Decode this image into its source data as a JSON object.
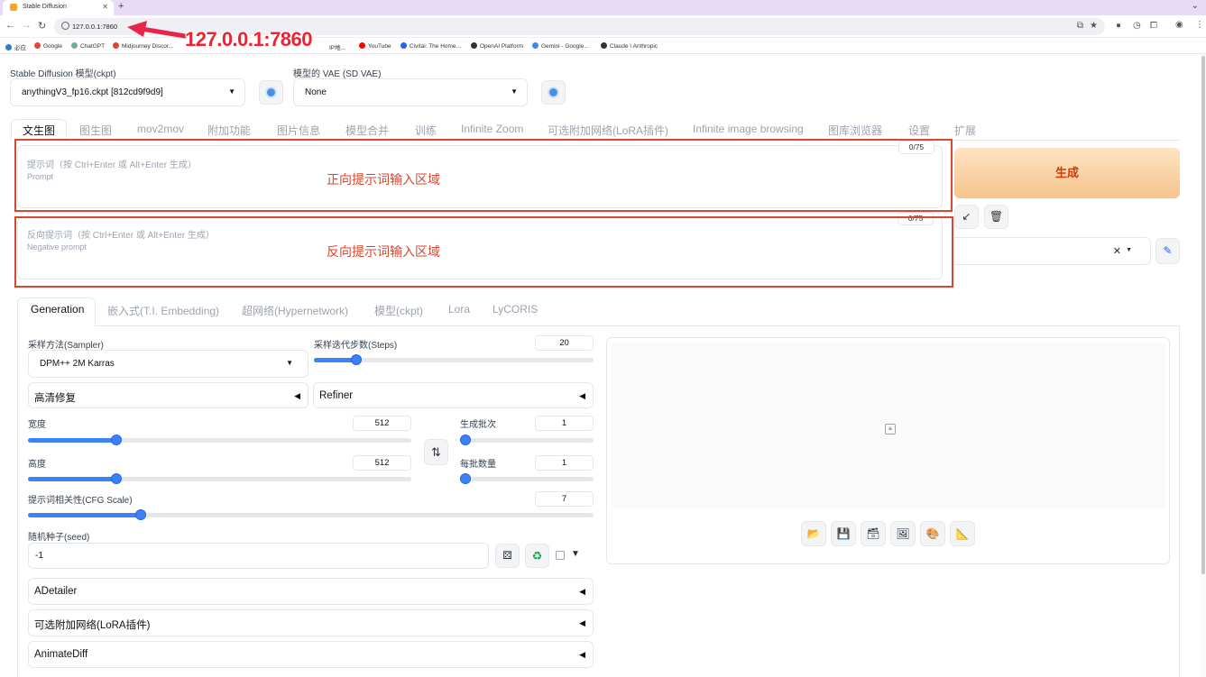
{
  "browser": {
    "tab_title": "Stable Diffusion",
    "url": "127.0.0.1:7860",
    "bookmarks": [
      {
        "label": "必应",
        "color": "#2b7cd3"
      },
      {
        "label": "Google",
        "color": "#ea4335"
      },
      {
        "label": "ChatGPT",
        "color": "#74aa9c"
      },
      {
        "label": "Midjourney Discor...",
        "color": "#d9472f"
      },
      {
        "label": "IP地...",
        "color": "#888888"
      },
      {
        "label": "YouTube",
        "color": "#ff0000"
      },
      {
        "label": "Civitai: The Home...",
        "color": "#1c64f2"
      },
      {
        "label": "OpenAI Platform",
        "color": "#333333"
      },
      {
        "label": "Gemini - Google...",
        "color": "#4285f4"
      },
      {
        "label": "Claude \\ Anthropic",
        "color": "#333333"
      }
    ]
  },
  "annotation": {
    "url_callout": "127.0.0.1:7860",
    "color": "#e8244a"
  },
  "model": {
    "ckpt_label": "Stable Diffusion 模型(ckpt)",
    "ckpt_value": "anythingV3_fp16.ckpt [812cd9f9d9]",
    "vae_label": "模型的 VAE (SD VAE)",
    "vae_value": "None"
  },
  "main_tabs": [
    "文生图",
    "图生图",
    "mov2mov",
    "附加功能",
    "图片信息",
    "模型合并",
    "训练",
    "Infinite Zoom",
    "可选附加网络(LoRA插件)",
    "Infinite image browsing",
    "图库浏览器",
    "设置",
    "扩展"
  ],
  "prompt": {
    "placeholder": "提示词（按 Ctrl+Enter 或 Alt+Enter 生成）",
    "placeholder_en": "Prompt",
    "counter": "0/75",
    "annotation": "正向提示词输入区域"
  },
  "negative_prompt": {
    "placeholder": "反向提示词（按 Ctrl+Enter 或 Alt+Enter 生成）",
    "placeholder_en": "Negative prompt",
    "counter": "0/75",
    "annotation": "反向提示词输入区域"
  },
  "generate_label": "生成",
  "annotation_color": "#d9472f",
  "sub_tabs": [
    "Generation",
    "嵌入式(T.I. Embedding)",
    "超网络(Hypernetwork)",
    "模型(ckpt)",
    "Lora",
    "LyCORIS"
  ],
  "generation": {
    "sampler_label": "采样方法(Sampler)",
    "sampler_value": "DPM++ 2M Karras",
    "steps_label": "采样迭代步数(Steps)",
    "steps_value": "20",
    "steps_fraction": 0.15,
    "hires_label": "高清修复",
    "refiner_label": "Refiner",
    "width_label": "宽度",
    "width_value": "512",
    "width_fraction": 0.23,
    "height_label": "高度",
    "height_value": "512",
    "height_fraction": 0.23,
    "batch_count_label": "生成批次",
    "batch_count_value": "1",
    "batch_count_fraction": 0.0,
    "batch_size_label": "每批数量",
    "batch_size_value": "1",
    "batch_size_fraction": 0.0,
    "cfg_label": "提示词相关性(CFG Scale)",
    "cfg_value": "7",
    "cfg_fraction": 0.2,
    "seed_label": "随机种子(seed)",
    "seed_value": "-1",
    "accordions": [
      "ADetailer",
      "可选附加网络(LoRA插件)",
      "AnimateDiff"
    ]
  },
  "accent_color": "#3b82f6"
}
